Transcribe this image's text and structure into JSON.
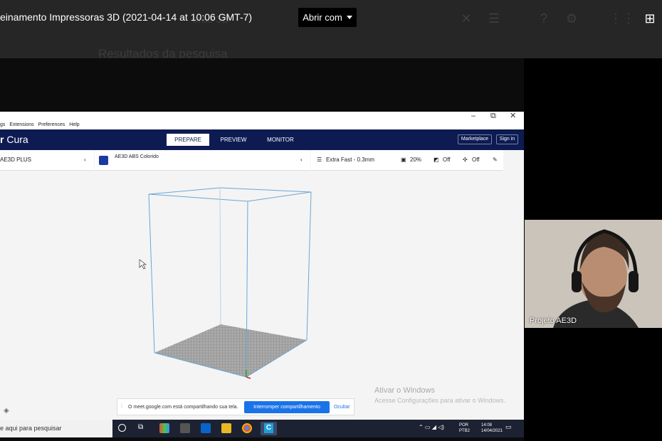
{
  "drive_bar": {
    "video_title": "einamento Impressoras 3D (2021-04-14 at 10:06 GMT-7)",
    "ghost_title": "oras 3D",
    "ghost_results": "Resultados da pesquisa",
    "open_with_label": "Abrir com"
  },
  "cura": {
    "window_controls": [
      "–",
      "⧉",
      "✕"
    ],
    "menu_items": [
      "gs",
      "Extensions",
      "Preferences",
      "Help"
    ],
    "logo_prefix": "r",
    "logo_name": "Cura",
    "tabs": [
      "PREPARE",
      "PREVIEW",
      "MONITOR"
    ],
    "active_tab": "PREPARE",
    "marketplace_label": "Marketplace",
    "signin_label": "Sign in",
    "printer_name": "AE3D PLUS",
    "material_name": "AE3D ABS Colorido",
    "profile_name": "Extra Fast - 0.3mm",
    "infill_value": "20%",
    "support_value": "Off",
    "adhesion_value": "Off"
  },
  "sharing_bar": {
    "message": "O meet.google.com está compartilhando sua tela.",
    "stop_label": "Interromper compartilhamento",
    "hide_label": "Ocultar"
  },
  "activate_windows": {
    "title": "Ativar o Windows",
    "subtitle": "Acesse Configurações para ativar o Windows."
  },
  "taskbar": {
    "search_placeholder": "e aqui para pesquisar",
    "lang_line1": "POR",
    "lang_line2": "PTB2",
    "time": "14:08",
    "date": "14/04/2021"
  },
  "participant": {
    "name": "Projeto AE3D"
  },
  "colors": {
    "cura_header": "#0d1b52",
    "stop_button": "#1a73e8",
    "build_volume": "#6aa6d6"
  }
}
